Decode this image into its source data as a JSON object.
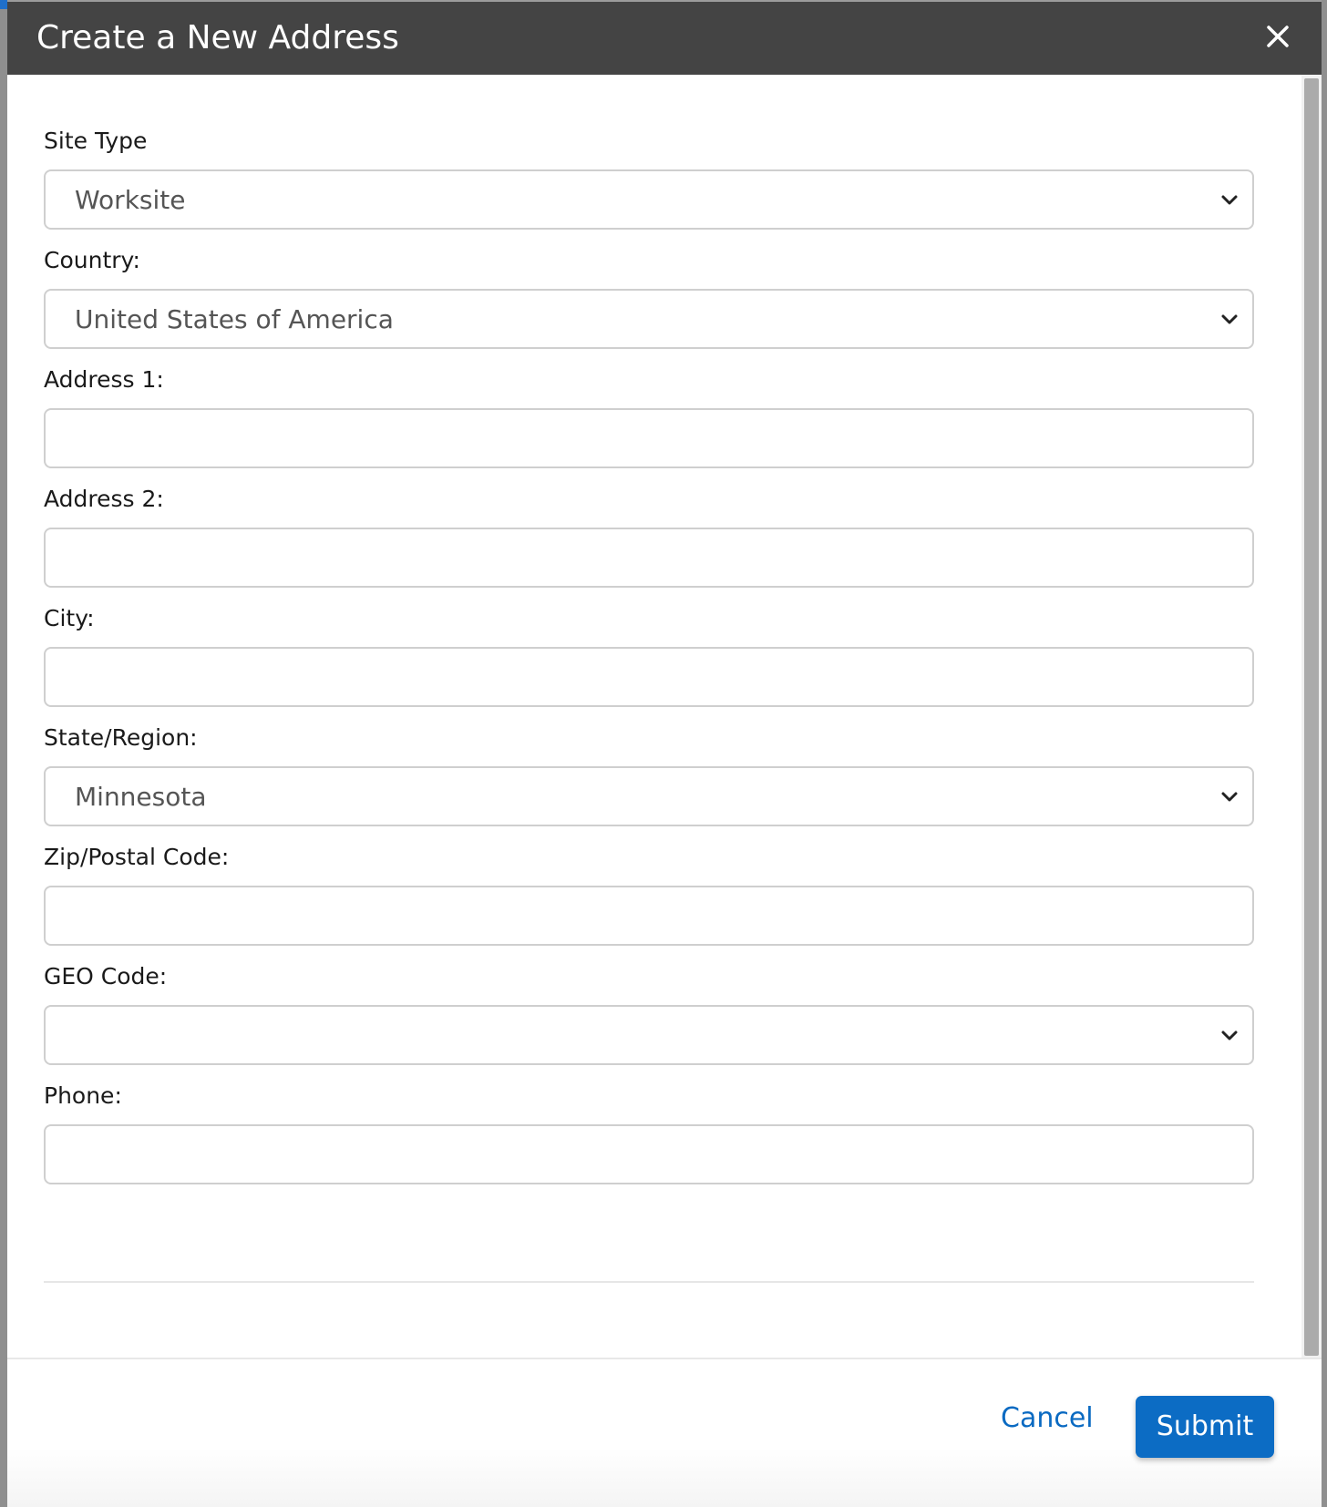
{
  "modal": {
    "title": "Create a New Address",
    "close_icon": "close-icon"
  },
  "form": {
    "site_type": {
      "label": "Site Type",
      "value": "Worksite"
    },
    "country": {
      "label": "Country:",
      "value": "United States of America"
    },
    "address1": {
      "label": "Address 1:",
      "value": ""
    },
    "address2": {
      "label": "Address 2:",
      "value": ""
    },
    "city": {
      "label": "City:",
      "value": ""
    },
    "state": {
      "label": "State/Region:",
      "value": "Minnesota"
    },
    "zip": {
      "label": "Zip/Postal Code:",
      "value": ""
    },
    "geo_code": {
      "label": "GEO Code:",
      "value": ""
    },
    "phone": {
      "label": "Phone:",
      "value": ""
    }
  },
  "footer": {
    "cancel_label": "Cancel",
    "submit_label": "Submit"
  },
  "colors": {
    "header_bg": "#444444",
    "accent": "#0c6cc4",
    "link": "#0a6ac2"
  }
}
